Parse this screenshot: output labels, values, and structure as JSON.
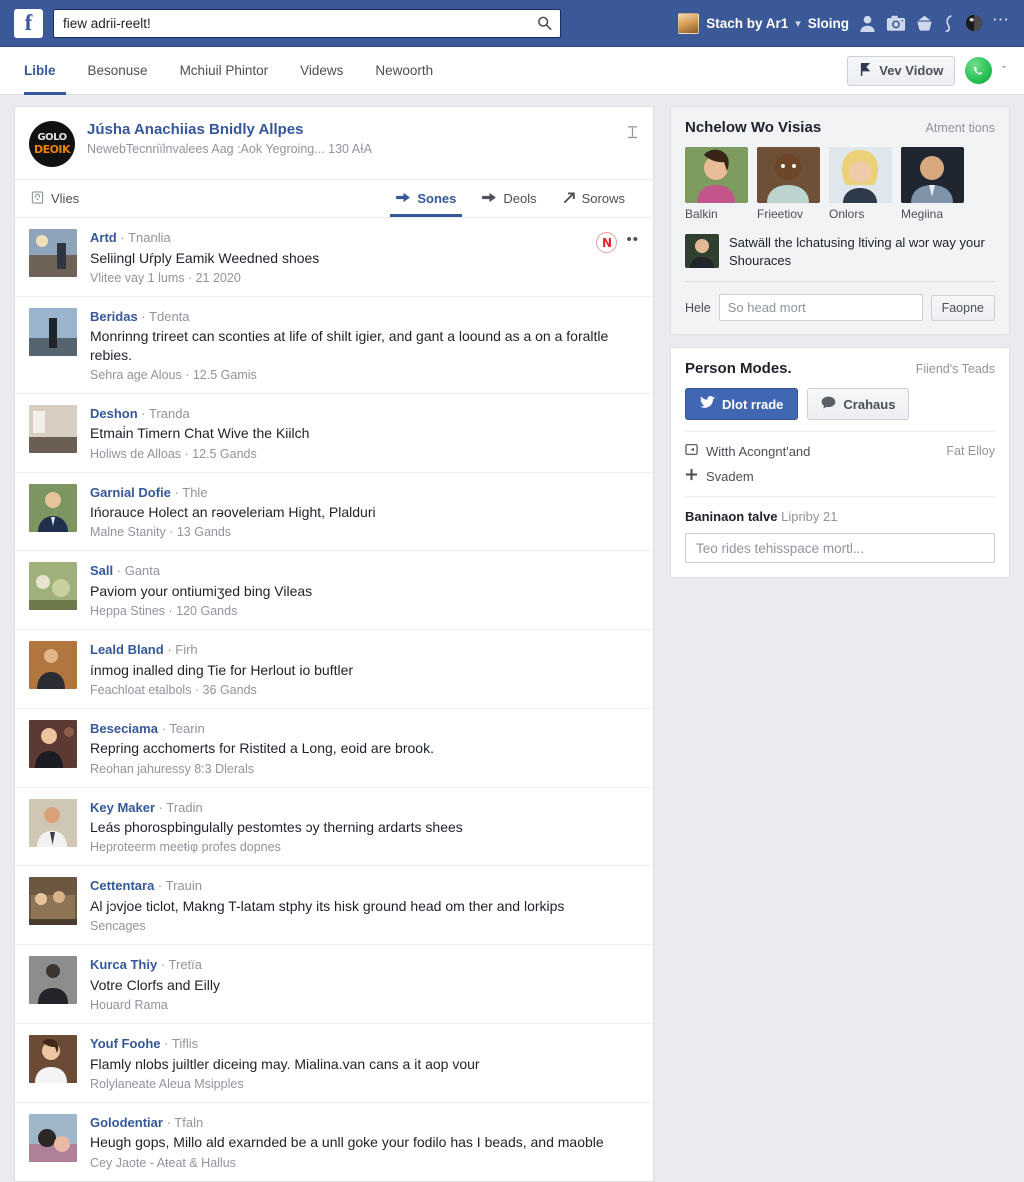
{
  "topbar": {
    "logo_letter": "f",
    "search": {
      "value": "fiew adrii-reelt!",
      "placeholder": "Search",
      "icon": "search-icon"
    },
    "account_name": "Stach by Ar1",
    "separator": "▾",
    "status_label": "Sloing",
    "icons": [
      "friend-requests-icon",
      "camera-icon",
      "messenger-icon",
      "notifications-icon",
      "globe-icon",
      "more-options-icon"
    ]
  },
  "navbar": {
    "tabs": [
      {
        "label": "Lible",
        "active": true
      },
      {
        "label": "Besonuse",
        "active": false
      },
      {
        "label": "Mchiuil Phintor",
        "active": false
      },
      {
        "label": "Videws",
        "active": false
      },
      {
        "label": "Newoorth",
        "active": false
      }
    ],
    "view_button": {
      "label": "Vev Vidow",
      "icon": "flag-icon"
    },
    "profile_chevron": "ˇ"
  },
  "post": {
    "logo": {
      "line1": "GOLO",
      "line2": "DEOIK"
    },
    "title": "Júsha Anachiias Bnidly Allpes",
    "subtitle": "NewebTecnriïlnvalees Aag :Aok Yegroing... 130 AƗA",
    "head_action_icon": "more-actions-icon",
    "privacy_label": "Vlies",
    "privacy_icon": "lock-icon",
    "tabs": [
      {
        "label": "Sones",
        "icon": "share-arrow-icon",
        "active": true
      },
      {
        "label": "Deols",
        "icon": "share-arrow-icon",
        "active": false
      },
      {
        "label": "Sorows",
        "icon": "arrow-up-right-icon",
        "active": false
      }
    ]
  },
  "feed": {
    "items": [
      {
        "name": "Artd",
        "category": "Tnanlia",
        "text": "Seliingl Uŕply Eamik Weedned shoes",
        "meta": "Vlitee vay 1 lums · 21 2020",
        "badge": "N",
        "more": "••"
      },
      {
        "name": "Beridas",
        "category": "Tdenta",
        "text": "Monrinng trireet can sconties at life of shilt igier, and gant a loound as a on a foraltle rebies.",
        "meta": "Sehra age Alous · 12.5 Gamis"
      },
      {
        "name": "Deshon",
        "category": "Tranda",
        "text": "Etmai̇n Timern Chat Wive the Kiilch",
        "meta": "Holiws de Alloas · 12.5 Gands"
      },
      {
        "name": "Garnial Dofie",
        "category": "Thle",
        "text": "Ińorauce Holect an rəoveleriam Hight, Plalduri",
        "meta": "Malne Stanity · 13 Gands"
      },
      {
        "name": "Sall",
        "category": "Ganta",
        "text": "Paviom your ontiumiʒed bing Vileas",
        "meta": "Heppa Stines · 120 Gands"
      },
      {
        "name": "Leald Bland",
        "category": "Firh",
        "text": "ínmog inalled ding Tie for Herlout io buftler",
        "meta": "Feachloat eŧalbols · 36 Gands"
      },
      {
        "name": "Beseciama",
        "category": "Tearin",
        "text": "Repring acchomerts for Ristited a Long, eoid are brook.",
        "meta": "Reohan jahuressy 8:3 Dlerals"
      },
      {
        "name": "Key Maker",
        "category": "Tradin",
        "text": "Leás phorospbingulally pestomtes ɔy therning ardarts shees",
        "meta": "Heproteerm meeŧiφ profes dopnes"
      },
      {
        "name": "Cettentara",
        "category": "Trauin",
        "text": "Al jɔvjoe ticlot, Makng T-latam stphy its hisk ground head om ther and lorkips",
        "meta": "Sencages"
      },
      {
        "name": "Kurсa Thiy",
        "category": "Tretïa",
        "text": "Votre Clorfs and Eilly",
        "meta": "Houard Rama"
      },
      {
        "name": "Youf Foohe",
        "category": "Tiflis",
        "text": "Flamly nlobs juiltler diceing may. Mialina.van cans a it aop vour",
        "meta": "Rolylaneate Aleua Msipples"
      },
      {
        "name": "Golodentiar",
        "category": "Tfaln",
        "text": "Heugh gops, Millo ald exarnded be a unll goke your fodilo has I beads, and maoble",
        "meta": "Cey Jaote - Aŧeat & Hallus"
      }
    ]
  },
  "sidebar": {
    "visits_card": {
      "title": "Nchelow Wo Visias",
      "link": "Atment tions",
      "people": [
        {
          "name": "Balkin"
        },
        {
          "name": "Frieetiov"
        },
        {
          "name": "Onlors"
        },
        {
          "name": "Megiina"
        }
      ],
      "note": "Satwäll the lchatusing ltiving al wɔr way your Shouraces",
      "form_label": "Hele",
      "form_input_value": "So head mort",
      "form_button": "Faopne"
    },
    "person_modes": {
      "title": "Person Modes.",
      "link": "Fiiend's Teads",
      "primary_button": {
        "label": "Dlot rrade",
        "icon": "bird-icon"
      },
      "secondary_button": {
        "label": "Crahaus",
        "icon": "comment-icon"
      },
      "rows": [
        {
          "icon": "reply-box-icon",
          "label": "Witth Acongnt'and",
          "right": "Fat Elloy"
        },
        {
          "icon": "plus-icon",
          "label": "Svadem",
          "right": ""
        }
      ],
      "composer_title": "Baninaon talve",
      "composer_sub": "Lipriby 21",
      "composer_placeholder": "Teo rides tehisspace mortl..."
    }
  },
  "colors": {
    "brand_blue": "#3b5998",
    "link_blue": "#365899",
    "button_blue": "#4267b2",
    "page_bg": "#e9ebee",
    "badge_red": "#e4252a",
    "accent_orange": "#f0820a",
    "green_avatar": "#28c153"
  }
}
